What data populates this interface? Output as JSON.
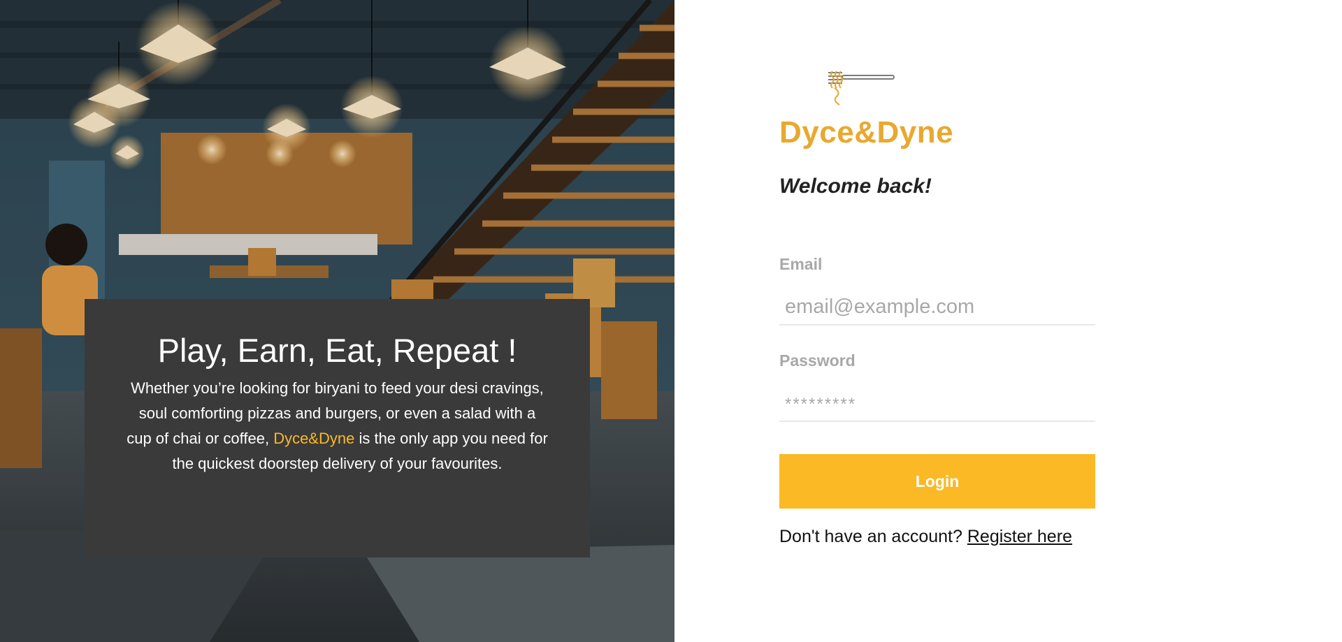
{
  "hero": {
    "title": "Play, Earn, Eat, Repeat !",
    "text_before": "Whether you’re looking for biryani to feed your desi cravings, soul comforting pizzas and burgers, or even a salad with a cup of chai or coffee,",
    "brand": "Dyce&Dyne",
    "text_after": "is the only app you need for the quickest doorstep delivery of your favourites.",
    "background_image": "restaurant-interior-photo"
  },
  "login": {
    "logo_icon": "fork-with-noodles-icon",
    "brand_name": "Dyce&Dyne",
    "welcome": "Welcome back!",
    "email_label": "Email",
    "email_placeholder": "email@example.com",
    "email_value": "",
    "password_label": "Password",
    "password_placeholder": "*********",
    "password_value": "",
    "login_label": "Login",
    "register_prompt": "Don't have an account?",
    "register_link": "Register here"
  },
  "colors": {
    "accent": "#fbb926",
    "brand_text": "#e9a82e",
    "card_background": "#3a3a3a",
    "label_gray": "#a8a8a8"
  }
}
